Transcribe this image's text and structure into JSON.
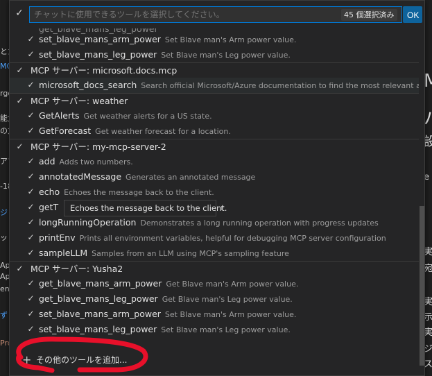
{
  "header": {
    "search_placeholder": "チャットに使用できるツールを選択してください。",
    "selected_count": "45 個選択済み",
    "ok_label": "OK"
  },
  "rows": [
    {
      "kind": "tool",
      "name": "set_blave_mans_arm_power",
      "desc": "Set Blave man's Arm power value."
    },
    {
      "kind": "tool",
      "name": "set_blave_mans_leg_power",
      "desc": "Set Blave man's Leg power value."
    },
    {
      "kind": "group",
      "name": "MCP サーバー: microsoft.docs.mcp"
    },
    {
      "kind": "tool",
      "name": "microsoft_docs_search",
      "desc": "Search official Microsoft/Azure documentation to find the most relevant an..."
    },
    {
      "kind": "group",
      "name": "MCP サーバー: weather"
    },
    {
      "kind": "tool",
      "name": "GetAlerts",
      "desc": "Get weather alerts for a US state."
    },
    {
      "kind": "tool",
      "name": "GetForecast",
      "desc": "Get weather forecast for a location."
    },
    {
      "kind": "group",
      "name": "MCP サーバー: my-mcp-server-2"
    },
    {
      "kind": "tool",
      "name": "add",
      "desc": "Adds two numbers."
    },
    {
      "kind": "tool",
      "name": "annotatedMessage",
      "desc": "Generates an annotated message"
    },
    {
      "kind": "tool",
      "name": "echo",
      "desc": "Echoes the message back to the client."
    },
    {
      "kind": "tool",
      "name": "getT",
      "desc": "r"
    },
    {
      "kind": "tool",
      "name": "longRunningOperation",
      "desc": "Demonstrates a long running operation with progress updates"
    },
    {
      "kind": "tool",
      "name": "printEnv",
      "desc": "Prints all environment variables, helpful for debugging MCP server configuration"
    },
    {
      "kind": "tool",
      "name": "sampleLLM",
      "desc": "Samples from an LLM using MCP's sampling feature"
    },
    {
      "kind": "group",
      "name": "MCP サーバー: Yusha2"
    },
    {
      "kind": "tool",
      "name": "get_blave_mans_arm_power",
      "desc": "Get Blave man's Arm power value."
    },
    {
      "kind": "tool",
      "name": "get_blave_mans_leg_power",
      "desc": "Get Blave man's Leg power value."
    },
    {
      "kind": "tool",
      "name": "set_blave_mans_arm_power",
      "desc": "Set Blave man's Arm power value."
    },
    {
      "kind": "tool",
      "name": "set_blave_mans_leg_power",
      "desc": "Set Blave man's Leg power value."
    }
  ],
  "tooltip": "Echoes the message back to the client.",
  "footer": {
    "add_label": "その他のツールを追加...",
    "icon": "plus-icon"
  },
  "background": {
    "left_fragments": [
      "とた",
      "MCP",
      "rger",
      "能力",
      "の力",
      "アフ",
      "-18",
      "ジ",
      "ット",
      "Ap",
      "Ap",
      "ent",
      "ず",
      "Pro"
    ],
    "right_fragments": [
      "M",
      "バ",
      "設",
      "e",
      "実",
      "宛",
      "実",
      "示",
      "実",
      "ジ",
      "ス"
    ]
  },
  "colors": {
    "accent": "#0078d4",
    "ok_button": "#0e639c",
    "annotation": "#e8102a"
  }
}
